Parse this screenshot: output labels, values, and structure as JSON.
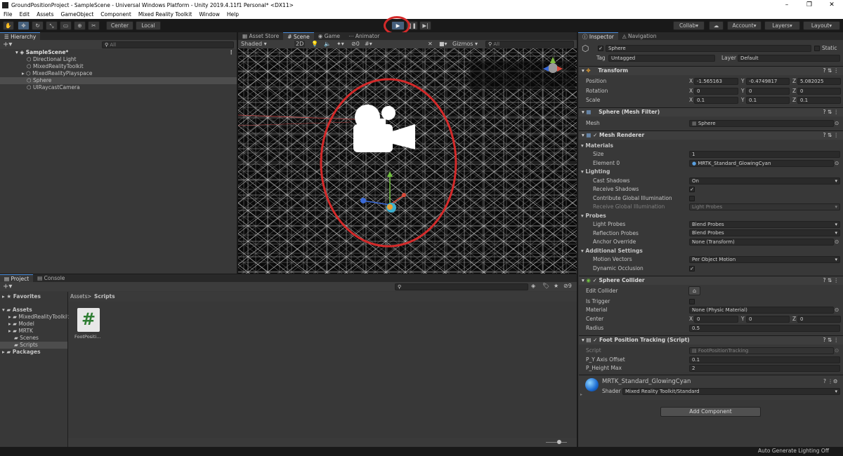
{
  "window": {
    "title": "GroundPositionProject - SampleScene - Universal Windows Platform - Unity 2019.4.11f1 Personal* <DX11>"
  },
  "menu": [
    "File",
    "Edit",
    "Assets",
    "GameObject",
    "Component",
    "Mixed Reality Toolkit",
    "Window",
    "Help"
  ],
  "toolbar": {
    "pivot": "Center",
    "space": "Local",
    "collab": "Collab",
    "account": "Account",
    "layers": "Layers",
    "layout": "Layout"
  },
  "hierarchy": {
    "tab": "Hierarchy",
    "search_placeholder": "All",
    "scene": "SampleScene*",
    "items": [
      "Directional Light",
      "MixedRealityToolkit",
      "MixedRealityPlayspace",
      "Sphere",
      "UIRaycastCamera"
    ]
  },
  "scene_view": {
    "tabs": [
      "Asset Store",
      "Scene",
      "Game",
      "Animator"
    ],
    "shading": "Shaded",
    "mode_2d": "2D",
    "hidden_count": "0",
    "gizmos": "Gizmos",
    "search_placeholder": "All"
  },
  "project": {
    "tabs": [
      "Project",
      "Console"
    ],
    "favorites": "Favorites",
    "assets": "Assets",
    "folders": [
      "MixedRealityToolkit",
      "Model",
      "MRTK",
      "Scenes",
      "Scripts"
    ],
    "packages": "Packages",
    "breadcrumb": [
      "Assets",
      "Scripts"
    ],
    "file_name": "FootPositi...",
    "hidden_count": "9"
  },
  "inspector": {
    "tabs": [
      "Inspector",
      "Navigation"
    ],
    "object_name": "Sphere",
    "static_label": "Static",
    "tag_label": "Tag",
    "tag_value": "Untagged",
    "layer_label": "Layer",
    "layer_value": "Default",
    "transform": {
      "title": "Transform",
      "position_label": "Position",
      "rotation_label": "Rotation",
      "scale_label": "Scale",
      "position": [
        "-1.565163",
        "-0.4749817",
        "5.082025"
      ],
      "rotation": [
        "0",
        "0",
        "0"
      ],
      "scale": [
        "0.1",
        "0.1",
        "0.1"
      ]
    },
    "mesh_filter": {
      "title": "Sphere (Mesh Filter)",
      "mesh_label": "Mesh",
      "mesh_value": "Sphere"
    },
    "mesh_renderer": {
      "title": "Mesh Renderer",
      "materials": "Materials",
      "size_label": "Size",
      "size_value": "1",
      "element_label": "Element 0",
      "element_value": "MRTK_Standard_GlowingCyan",
      "lighting": "Lighting",
      "cast_shadows_label": "Cast Shadows",
      "cast_shadows_value": "On",
      "receive_shadows_label": "Receive Shadows",
      "contribute_gi_label": "Contribute Global Illumination",
      "receive_gi_label": "Receive Global Illumination",
      "receive_gi_value": "Light Probes",
      "probes": "Probes",
      "light_probes_label": "Light Probes",
      "light_probes_value": "Blend Probes",
      "reflection_probes_label": "Reflection Probes",
      "reflection_probes_value": "Blend Probes",
      "anchor_label": "Anchor Override",
      "anchor_value": "None (Transform)",
      "additional": "Additional Settings",
      "motion_label": "Motion Vectors",
      "motion_value": "Per Object Motion",
      "dynamic_occlusion_label": "Dynamic Occlusion"
    },
    "sphere_collider": {
      "title": "Sphere Collider",
      "edit_label": "Edit Collider",
      "trigger_label": "Is Trigger",
      "material_label": "Material",
      "material_value": "None (Physic Material)",
      "center_label": "Center",
      "center": [
        "0",
        "0",
        "0"
      ],
      "radius_label": "Radius",
      "radius_value": "0.5"
    },
    "script": {
      "title": "Foot Position Tracking (Script)",
      "script_label": "Script",
      "script_value": "FootPositionTracking",
      "offset_label": "P_Y Axis Offset",
      "offset_value": "0.1",
      "height_label": "P_Height Max",
      "height_value": "2"
    },
    "material": {
      "name": "MRTK_Standard_GlowingCyan",
      "shader_label": "Shader",
      "shader_value": "Mixed Reality Toolkit/Standard"
    },
    "add_component": "Add Component"
  },
  "status": "Auto Generate Lighting Off",
  "colors": {
    "accent": "#46607c",
    "highlight_circle": "#d42a2a"
  }
}
